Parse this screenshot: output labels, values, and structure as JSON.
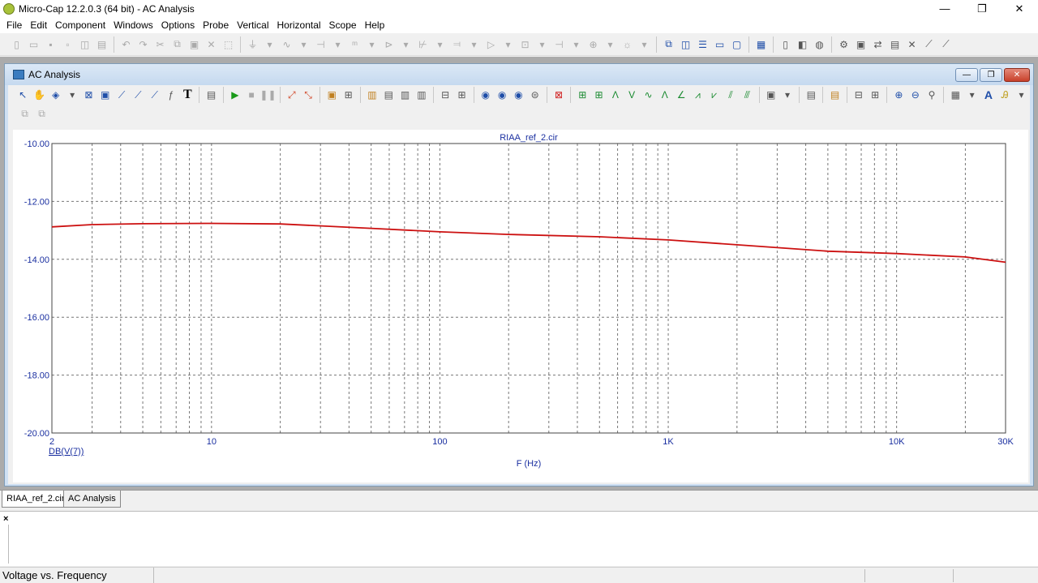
{
  "window": {
    "title": "Micro-Cap 12.2.0.3 (64 bit) - AC Analysis",
    "minimize": "—",
    "restore": "❐",
    "close": "✕"
  },
  "menu": [
    "File",
    "Edit",
    "Component",
    "Windows",
    "Options",
    "Probe",
    "Vertical",
    "Horizontal",
    "Scope",
    "Help"
  ],
  "child": {
    "title": "AC Analysis",
    "text_tool": "T",
    "font_tool": "A"
  },
  "tabs": [
    "RIAA_ref_2.cir",
    "AC Analysis"
  ],
  "output": {
    "close": "×"
  },
  "status": {
    "text": "Voltage vs. Frequency"
  },
  "colors": {
    "trace": "#cc1010",
    "axis_text": "#1a2fa0",
    "grid": "#777777"
  },
  "chart_data": {
    "type": "line",
    "title": "RIAA_ref_2.cir",
    "xlabel": "F (Hz)",
    "ylabel": "",
    "x_scale": "log",
    "xlim": [
      2,
      30000
    ],
    "ylim": [
      -20,
      -10
    ],
    "x_tick_labels": [
      "2",
      "10",
      "100",
      "1K",
      "10K",
      "30K"
    ],
    "x_tick_values": [
      2,
      10,
      100,
      1000,
      10000,
      30000
    ],
    "y_tick_labels": [
      "-10.00",
      "-12.00",
      "-14.00",
      "-16.00",
      "-18.00",
      "-20.00"
    ],
    "y_tick_values": [
      -10,
      -12,
      -14,
      -16,
      -18,
      -20
    ],
    "grid": true,
    "series": [
      {
        "name": "DB(V(7))",
        "x": [
          2,
          3,
          5,
          10,
          20,
          50,
          100,
          200,
          500,
          1000,
          2000,
          5000,
          10000,
          20000,
          30000
        ],
        "y": [
          -12.88,
          -12.8,
          -12.77,
          -12.76,
          -12.78,
          -12.93,
          -13.05,
          -13.14,
          -13.22,
          -13.33,
          -13.5,
          -13.72,
          -13.8,
          -13.92,
          -14.1
        ]
      }
    ]
  }
}
